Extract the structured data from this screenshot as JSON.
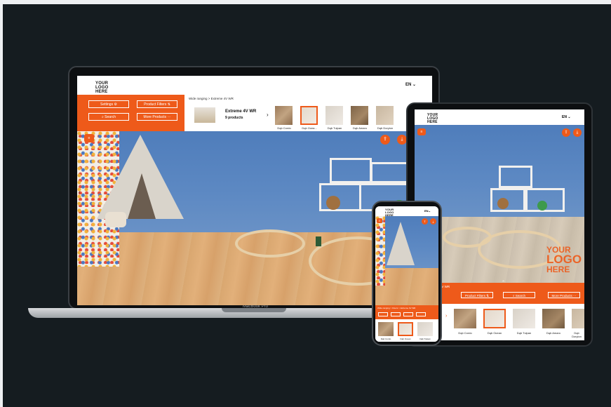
{
  "laptop": {
    "logo": "YOUR LOGO HERE",
    "lang": "EN",
    "breadcrumb": "Wide ranging  >  Extreme 4V WR",
    "buttons": {
      "settings": "Settings",
      "product_filters": "Product Filters",
      "search": "Search",
      "more_products": "More Products"
    },
    "product_title": "Extreme 4V WR",
    "product_count": "9 products",
    "swatches": [
      "Dąb Cordo",
      "Dąb Ocea...",
      "Dąb Tulpan",
      "Dąb Amaro",
      "Dąb Doryion"
    ],
    "brand_label": "MacBook Pro"
  },
  "tablet": {
    "logo": "YOUR LOGO HERE",
    "lang": "EN",
    "watermark": [
      "YOUR",
      "LOGO",
      "HERE"
    ],
    "breadcrumb": "...ng  >  Extreme 4V WR",
    "buttons": {
      "product_filters": "Product Filters",
      "search": "Search",
      "more_products": "More Products"
    },
    "swatches": [
      "Dąb Cordo",
      "Dąb Ocean",
      "Dąb Tulpan",
      "Dąb Amaro",
      "Dąb Doryion"
    ]
  },
  "phone": {
    "logo": "YOUR LOGO HERE",
    "lang": "EN",
    "breadcrumb": "Wide ranging  >  Floors  >  Extreme 4V WR",
    "swatches": [
      "Dąb Cordo",
      "Dąb Ocean",
      "Dąb Tulpan"
    ]
  },
  "colors": {
    "accent": "#ee5a1a",
    "background": "#151c20"
  }
}
